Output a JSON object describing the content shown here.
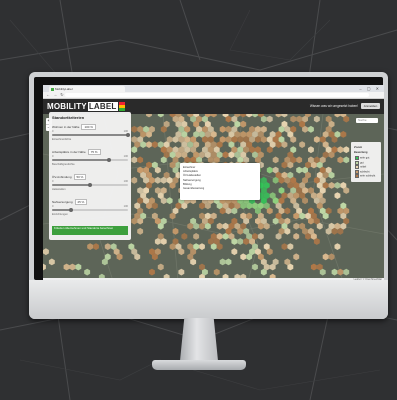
{
  "browser": {
    "tab_title": "MobilityLabel",
    "url": "",
    "window_controls": "– ▢ ✕",
    "nav_glyphs": "← → ↻"
  },
  "app": {
    "logo_text": "MOBILITY",
    "logo_label": "LABEL",
    "header_link": "Wissen was wir umgesetzt haben!",
    "header_button": "Anmelden"
  },
  "map": {
    "zoom_in": "+",
    "zoom_out": "−",
    "search_placeholder": "Suche",
    "footer_attribution": "Leaflet | © OpenStreetMap",
    "hex_colors": [
      "#e8d4b0",
      "#d9b98f",
      "#c79a6a",
      "#b07848",
      "#bfd9a6",
      "#8fd07e",
      "#4fbf52"
    ],
    "highlight_color": "#34c759"
  },
  "panel": {
    "title": "Standortkriterien",
    "rows": [
      {
        "label": "Wohnen in der Nähe",
        "value": "100 %",
        "sub": "Einwohnerdichte",
        "left": "0",
        "right": "100",
        "fill": 1.0
      },
      {
        "label": "Arbeitsplätze in der Nähe",
        "value": "75 %",
        "sub": "Beschäftigtendichte",
        "left": "0",
        "right": "100",
        "fill": 0.75
      },
      {
        "label": "ÖV-Anbindung",
        "value": "50 %",
        "sub": "Haltestellen",
        "left": "0",
        "right": "100",
        "fill": 0.5
      },
      {
        "label": "Nahversorgung",
        "value": "25 %",
        "sub": "Einrichtungen",
        "left": "0",
        "right": "100",
        "fill": 0.25
      }
    ],
    "apply_button": "Kriterien übernehmen und Standorte berechnen"
  },
  "popup": {
    "rows": [
      {
        "label": "Einwohner",
        "v1": "",
        "v2": ""
      },
      {
        "label": "Arbeitsplätze",
        "v1": "",
        "v2": ""
      },
      {
        "label": "ÖV-Haltestellen",
        "v1": "",
        "v2": ""
      },
      {
        "label": "Nahversorgung",
        "v1": "",
        "v2": ""
      },
      {
        "label": "Bildung",
        "v1": "",
        "v2": ""
      },
      {
        "label": "Gesamtbewertung",
        "v1": "",
        "v2": ""
      }
    ],
    "footer": ""
  },
  "legend": {
    "title": "Zoom",
    "subtitle": "Bewertung",
    "items": [
      {
        "label": "sehr gut",
        "color": "#34c759"
      },
      {
        "label": "gut",
        "color": "#bfd9a6"
      },
      {
        "label": "mittel",
        "color": "#e8d4b0"
      },
      {
        "label": "schlecht",
        "color": "#c79a6a"
      },
      {
        "label": "sehr schlecht",
        "color": "#b07848"
      }
    ]
  }
}
